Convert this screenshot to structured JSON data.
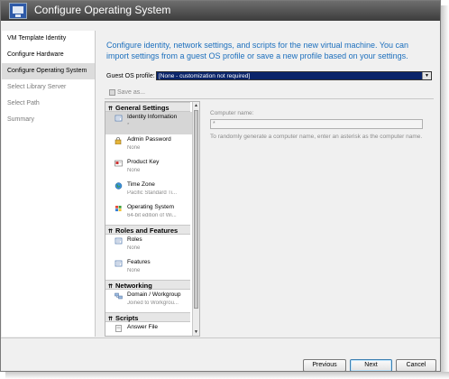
{
  "window": {
    "title": "Configure Operating System",
    "icon": "vm-wizard-icon"
  },
  "sidebar": {
    "items": [
      {
        "label": "VM Template Identity",
        "state": "done"
      },
      {
        "label": "Configure Hardware",
        "state": "done"
      },
      {
        "label": "Configure Operating System",
        "state": "active"
      },
      {
        "label": "Select Library Server",
        "state": "pending"
      },
      {
        "label": "Select Path",
        "state": "pending"
      },
      {
        "label": "Summary",
        "state": "pending"
      }
    ]
  },
  "main": {
    "intro": "Configure identity, network settings, and scripts for the new virtual machine. You can import settings from a guest OS profile or save a new profile based on your settings.",
    "guest_os_label": "Guest OS profile:",
    "guest_os_value": "[None - customization not required]",
    "save_as_label": "Save as...",
    "tree": {
      "groups": [
        {
          "title": "General Settings",
          "items": [
            {
              "name": "Identity Information",
              "value": "*",
              "icon": "identity-icon",
              "selected": true
            },
            {
              "name": "Admin Password",
              "value": "None",
              "icon": "key-lock-icon"
            },
            {
              "name": "Product Key",
              "value": "None",
              "icon": "product-key-icon"
            },
            {
              "name": "Time Zone",
              "value": "Pacific Standard Ti...",
              "icon": "globe-icon"
            },
            {
              "name": "Operating System",
              "value": "64-bit edition of Wi...",
              "icon": "windows-icon"
            }
          ]
        },
        {
          "title": "Roles and Features",
          "items": [
            {
              "name": "Roles",
              "value": "None",
              "icon": "roles-icon"
            },
            {
              "name": "Features",
              "value": "None",
              "icon": "features-icon"
            }
          ]
        },
        {
          "title": "Networking",
          "items": [
            {
              "name": "Domain / Workgroup",
              "value": "Joined to Workgrou...",
              "icon": "network-icon"
            }
          ]
        },
        {
          "title": "Scripts",
          "items": [
            {
              "name": "Answer File",
              "value": "",
              "icon": "answer-file-icon"
            }
          ]
        }
      ]
    },
    "detail": {
      "computer_name_label": "Computer name:",
      "computer_name_value": "*",
      "hint": "To randomly generate a computer name, enter an asterisk as the computer name."
    }
  },
  "buttons": {
    "previous": "Previous",
    "next": "Next",
    "cancel": "Cancel"
  },
  "colors": {
    "intro_text": "#1c6fbd",
    "selected_profile_bg": "#0a246a",
    "title_bar": "#4a4a4a"
  }
}
